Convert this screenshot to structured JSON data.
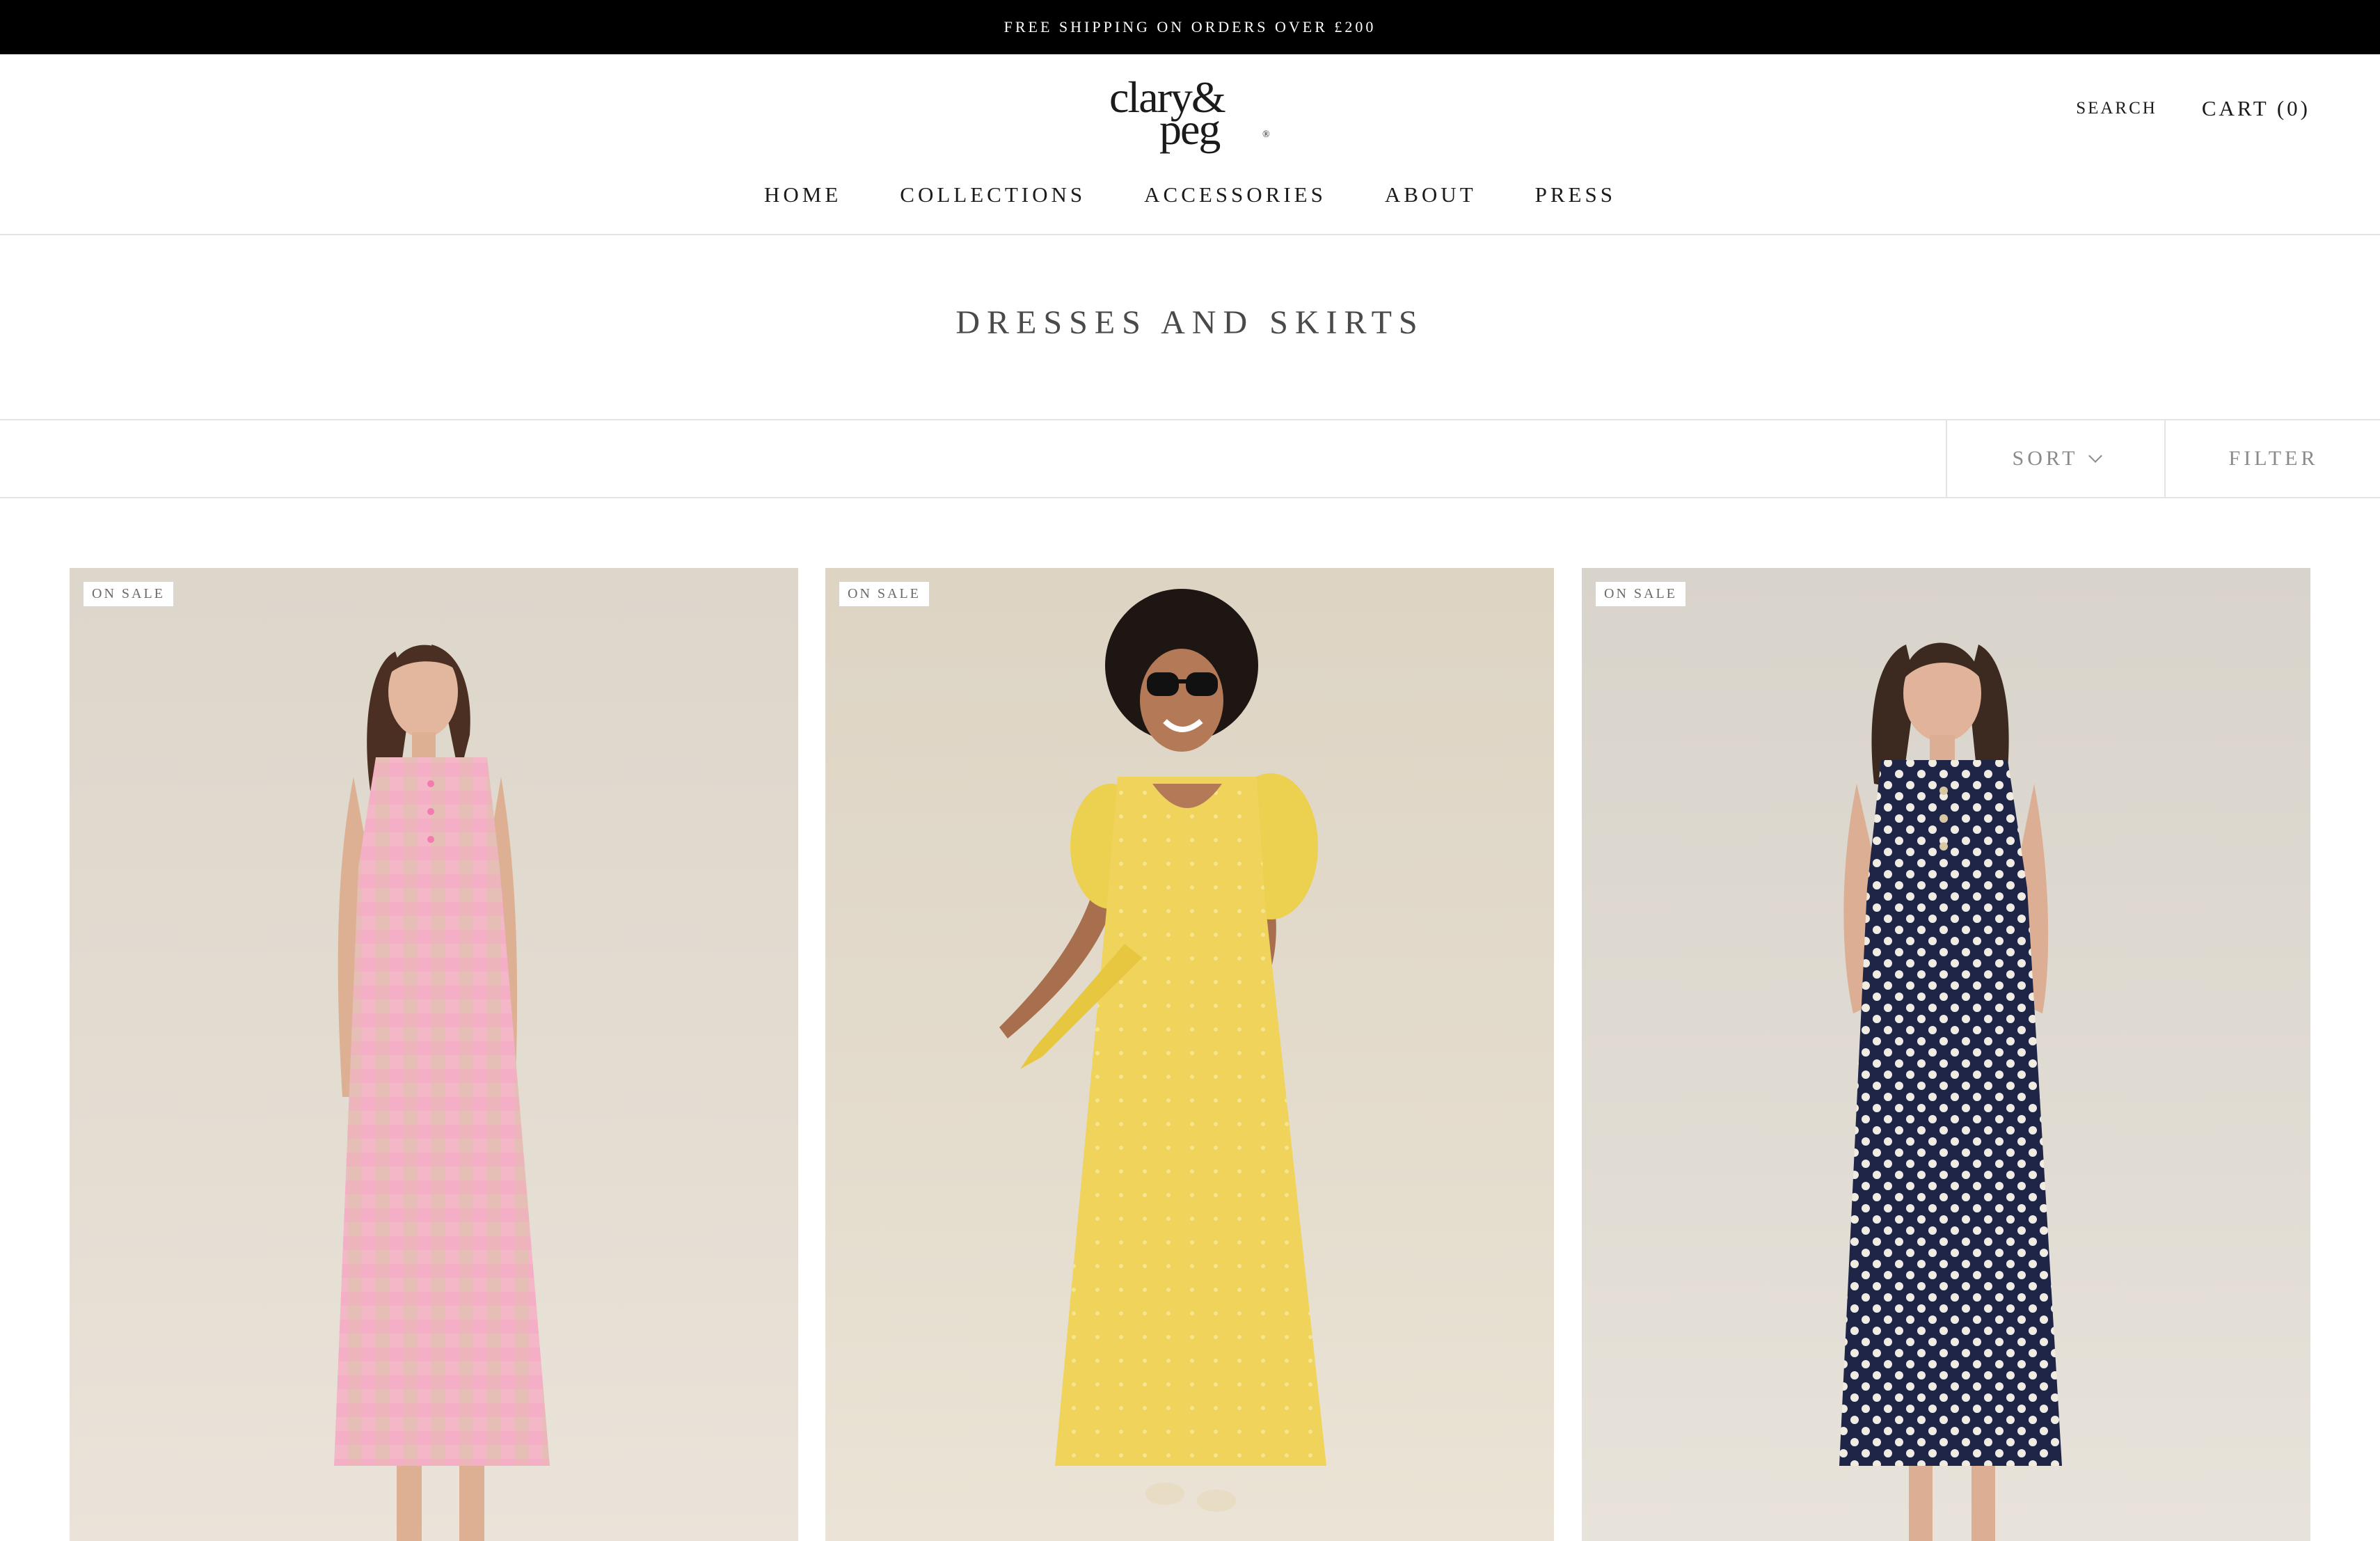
{
  "announcement": "FREE SHIPPING ON ORDERS OVER £200",
  "brand": {
    "logo_line1": "clary&",
    "logo_line2": "peg",
    "logo_mark": "®"
  },
  "header": {
    "search": "SEARCH",
    "cart": "CART (0)"
  },
  "nav": [
    "HOME",
    "COLLECTIONS",
    "ACCESSORIES",
    "ABOUT",
    "PRESS"
  ],
  "collection": {
    "title": "DRESSES AND SKIRTS"
  },
  "toolbar": {
    "sort": "SORT",
    "filter": "FILTER"
  },
  "products": [
    {
      "badge": "ON SALE",
      "image": "pink-gingham-sleeveless-maxi-dress"
    },
    {
      "badge": "ON SALE",
      "image": "yellow-puff-sleeve-maxi-dress"
    },
    {
      "badge": "ON SALE",
      "image": "navy-polka-dot-sleeveless-maxi-dress"
    }
  ],
  "colors": {
    "announcement_bg": "#000000",
    "text": "#1c1b1b",
    "muted": "#8a8a8a",
    "divider": "#e4e4e4"
  }
}
